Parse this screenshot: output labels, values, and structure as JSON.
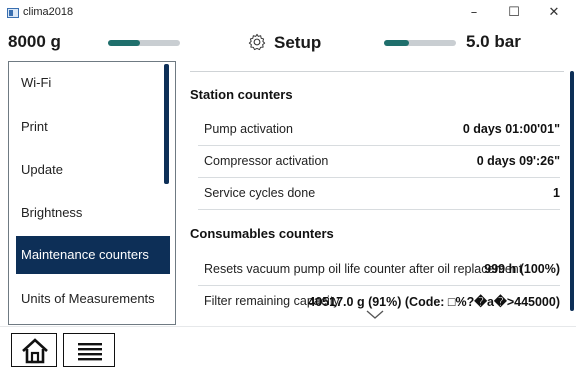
{
  "window": {
    "title": "clima2018",
    "minimize": "–",
    "maximize": "☐",
    "close": "✕"
  },
  "header": {
    "weight": "8000 g",
    "weight_level": 0.45,
    "title": "Setup",
    "title_icon": "gear-icon",
    "pressure": "5.0 bar",
    "pressure_level": 0.35,
    "accent_color": "#1f6f6c"
  },
  "sidebar": {
    "items": [
      {
        "label": "Wi-Fi"
      },
      {
        "label": "Print"
      },
      {
        "label": "Update"
      },
      {
        "label": "Brightness"
      },
      {
        "label": "Maintenance counters",
        "active": true
      },
      {
        "label": "Units of Measurements"
      }
    ],
    "active_color": "#0d2f57"
  },
  "main": {
    "sections": [
      {
        "title": "Station counters",
        "rows": [
          {
            "label": "Pump activation",
            "value": "0 days  01:00'01\""
          },
          {
            "label": "Compressor activation",
            "value": "0 days  09':26\""
          },
          {
            "label": "Service cycles done",
            "value": "1"
          }
        ]
      },
      {
        "title": "Consumables counters",
        "rows": [
          {
            "label": "Resets vacuum pump oil life counter after oil replacement",
            "value": "999 h (100%)"
          },
          {
            "label": "Filter remaining capacity",
            "value": "40517.0 g (91%) (Code: □%?�a�>445000)"
          }
        ]
      }
    ]
  },
  "footer": {
    "home_icon": "home-icon",
    "menu_icon": "menu-icon"
  }
}
